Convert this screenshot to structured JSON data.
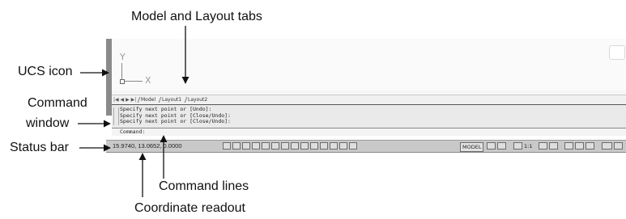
{
  "callouts": {
    "model_layout_tabs": "Model and Layout tabs",
    "ucs_icon": "UCS icon",
    "command_window_line1": "Command",
    "command_window_line2": "window",
    "status_bar": "Status bar",
    "command_lines": "Command lines",
    "coordinate_readout": "Coordinate readout"
  },
  "ucs": {
    "y_label": "Y",
    "x_label": "X"
  },
  "layout_tabs": {
    "nav": "|◀ ◀ ▶ ▶|",
    "tabs": [
      "Model",
      "Layout1",
      "Layout2"
    ]
  },
  "command_window": {
    "history": [
      "Specify next point or [Undo]:",
      "Specify next point or [Close/Undo]:",
      "Specify next point or [Close/Undo]:"
    ],
    "prompt": "Command:"
  },
  "status_bar": {
    "coordinates": "15.9740, 13.0652, 0.0000",
    "model_button": "MODEL",
    "annotation_scale": "1:1",
    "drafting_tool_icons": [
      "infer-constraints-icon",
      "snap-icon",
      "grid-icon",
      "ortho-icon",
      "polar-icon",
      "osnap-icon",
      "3d-osnap-icon",
      "otrack-icon",
      "ducs-icon",
      "dyn-icon",
      "lineweight-icon",
      "transparency-icon",
      "quick-properties-icon",
      "selection-cycling-icon"
    ]
  }
}
